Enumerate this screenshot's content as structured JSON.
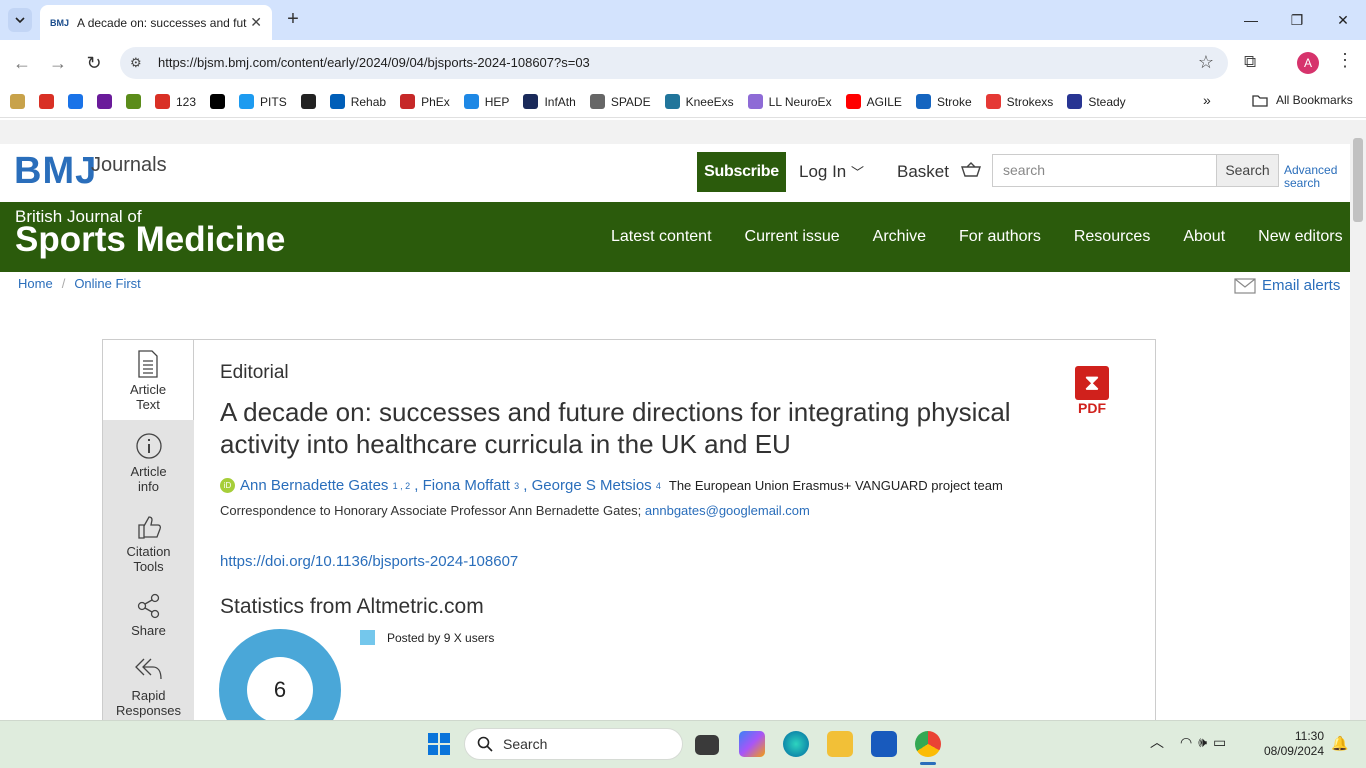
{
  "browser": {
    "tab_title": "A decade on: successes and fut",
    "tab_favicon": "BMJ",
    "url": "https://bjsm.bmj.com/content/early/2024/09/04/bjsports-2024-108607?s=03",
    "profile_initial": "A",
    "bookmarks": [
      {
        "label": "",
        "icon": "fd-icon",
        "color": "#c8a24a"
      },
      {
        "label": "",
        "icon": "gmail-icon",
        "color": "#d93025"
      },
      {
        "label": "",
        "icon": "drive-icon",
        "color": "#1a73e8"
      },
      {
        "label": "",
        "icon": "c-icon",
        "color": "#6a1b9a"
      },
      {
        "label": "",
        "icon": "green-bar-icon",
        "color": "#5b8c1a"
      },
      {
        "label": "123",
        "icon": "dots-icon",
        "color": "#d93025"
      },
      {
        "label": "",
        "icon": "x-icon",
        "color": "#000000"
      },
      {
        "label": "PITS",
        "icon": "twitter-icon",
        "color": "#1d9bf0"
      },
      {
        "label": "",
        "icon": "nih-icon",
        "color": "#222222"
      },
      {
        "label": "Rehab",
        "icon": "nhs-icon",
        "color": "#005eb8"
      },
      {
        "label": "PhEx",
        "icon": "phex-icon",
        "color": "#c62828"
      },
      {
        "label": "HEP",
        "icon": "hep-icon",
        "color": "#1e88e5"
      },
      {
        "label": "InfAth",
        "icon": "infath-icon",
        "color": "#1a2a5a"
      },
      {
        "label": "SPADE",
        "icon": "spade-icon",
        "color": "#666666"
      },
      {
        "label": "KneeExs",
        "icon": "wordpress-icon",
        "color": "#21759b"
      },
      {
        "label": "LL NeuroEx",
        "icon": "brain-icon",
        "color": "#8e6bd6"
      },
      {
        "label": "AGILE",
        "icon": "youtube-icon",
        "color": "#ff0000"
      },
      {
        "label": "Stroke",
        "icon": "me-icon",
        "color": "#1565c0"
      },
      {
        "label": "Strokexs",
        "icon": "strokexs-icon",
        "color": "#e53935"
      },
      {
        "label": "Steady",
        "icon": "steady-icon",
        "color": "#283593"
      }
    ],
    "all_bookmarks": "All Bookmarks"
  },
  "site": {
    "logo": "BMJ",
    "logo_suffix": "Journals",
    "subscribe": "Subscribe",
    "login": "Log In",
    "basket": "Basket",
    "search_placeholder": "search",
    "search_button": "Search",
    "advanced_search_1": "Advanced",
    "advanced_search_2": "search",
    "journal_line1": "British Journal of",
    "journal_line2": "Sports Medicine",
    "nav": [
      "Latest content",
      "Current issue",
      "Archive",
      "For authors",
      "Resources",
      "About",
      "New editors"
    ],
    "breadcrumb": [
      "Home",
      "Online First"
    ],
    "email_alerts": "Email alerts"
  },
  "sidebar": [
    {
      "label1": "Article",
      "label2": "Text"
    },
    {
      "label1": "Article",
      "label2": "info"
    },
    {
      "label1": "Citation",
      "label2": "Tools"
    },
    {
      "label1": "Share",
      "label2": ""
    },
    {
      "label1": "Rapid",
      "label2": "Responses"
    }
  ],
  "article": {
    "kind": "Editorial",
    "title": "A decade on: successes and future directions for integrating physical activity into healthcare curricula in the UK and EU",
    "authors": [
      {
        "name": "Ann Bernadette Gates",
        "sup": "1 , 2"
      },
      {
        "name": "Fiona Moffatt",
        "sup": "3"
      },
      {
        "name": "George S Metsios",
        "sup": "4"
      }
    ],
    "team": "The European Union Erasmus+ VANGUARD project team",
    "correspondence": "Correspondence to Honorary Associate Professor Ann Bernadette Gates; ",
    "email": "annbgates@googlemail.com",
    "doi": "https://doi.org/10.1136/bjsports-2024-108607",
    "stats_heading": "Statistics from Altmetric.com",
    "altmetric_score": "6",
    "legend": "Posted by 9 X users",
    "pdf": "PDF"
  },
  "taskbar": {
    "search": "Search",
    "time": "11:30",
    "date": "08/09/2024"
  }
}
